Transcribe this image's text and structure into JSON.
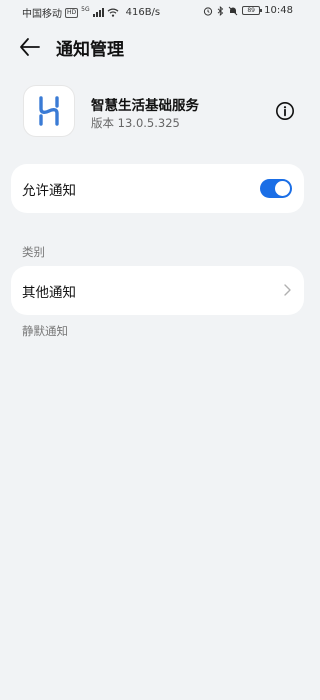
{
  "status_bar": {
    "carrier": "中国移动",
    "hd": "HD",
    "network": "5G",
    "speed": "416B/s",
    "battery": "89",
    "time": "10:48"
  },
  "header": {
    "title": "通知管理"
  },
  "app": {
    "name": "智慧生活基础服务",
    "version": "版本 13.0.5.325",
    "icon_color": "#3a7bd5"
  },
  "allow_notifications": {
    "label": "允许通知",
    "enabled": true,
    "accent": "#1a6ee6"
  },
  "categories": {
    "section_title": "类别",
    "items": [
      {
        "label": "其他通知"
      }
    ]
  },
  "silent": {
    "section_title": "静默通知"
  }
}
